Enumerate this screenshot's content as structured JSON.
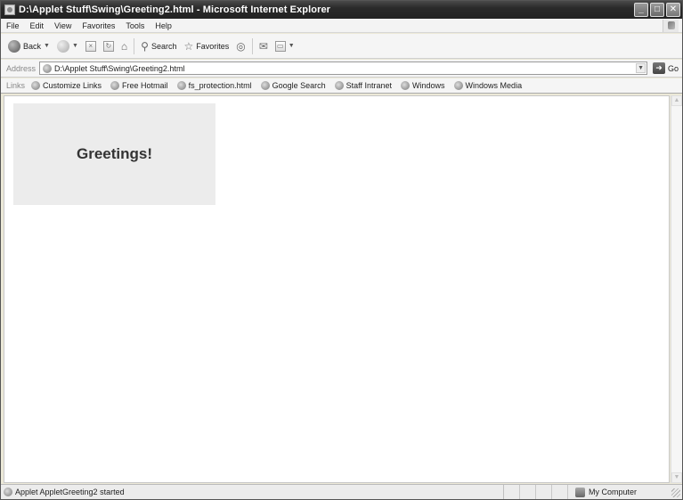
{
  "window": {
    "title": "D:\\Applet Stuff\\Swing\\Greeting2.html - Microsoft Internet Explorer",
    "minimize": "_",
    "maximize": "□",
    "close": "✕"
  },
  "menu": {
    "items": [
      "File",
      "Edit",
      "View",
      "Favorites",
      "Tools",
      "Help"
    ]
  },
  "toolbar": {
    "back_label": "Back",
    "search_label": "Search",
    "favorites_label": "Favorites"
  },
  "address": {
    "label": "Address",
    "value": "D:\\Applet Stuff\\Swing\\Greeting2.html",
    "go_label": "Go"
  },
  "links": {
    "label": "Links",
    "items": [
      "Customize Links",
      "Free Hotmail",
      "fs_protection.html",
      "Google Search",
      "Staff Intranet",
      "Windows",
      "Windows Media"
    ]
  },
  "content": {
    "applet_text": "Greetings!"
  },
  "status": {
    "message": "Applet AppletGreeting2 started",
    "zone": "My Computer"
  }
}
